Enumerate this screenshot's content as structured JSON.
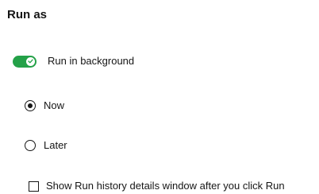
{
  "section": {
    "title": "Run as"
  },
  "background_toggle": {
    "label": "Run in background",
    "checked": true,
    "color": "#24a148"
  },
  "run_time": {
    "options": [
      {
        "label": "Now",
        "selected": true
      },
      {
        "label": "Later",
        "selected": false
      }
    ]
  },
  "history_checkbox": {
    "label": "Show Run history details window after you click Run",
    "checked": false
  }
}
